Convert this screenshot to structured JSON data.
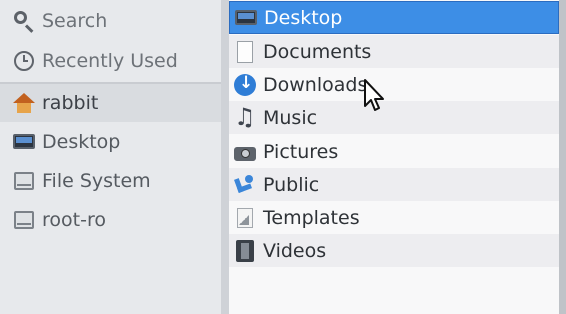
{
  "sidebar": {
    "items": [
      {
        "label": "Search",
        "icon": "search-icon"
      },
      {
        "label": "Recently Used",
        "icon": "clock-icon"
      },
      {
        "label": "rabbit",
        "icon": "home-folder-icon"
      },
      {
        "label": "Desktop",
        "icon": "desktop-icon"
      },
      {
        "label": "File System",
        "icon": "drive-icon"
      },
      {
        "label": "root-ro",
        "icon": "drive-icon"
      }
    ]
  },
  "files": {
    "rows": [
      {
        "name": "Desktop",
        "icon": "desktop-icon"
      },
      {
        "name": "Documents",
        "icon": "documents-icon"
      },
      {
        "name": "Downloads",
        "icon": "downloads-icon"
      },
      {
        "name": "Music",
        "icon": "music-icon"
      },
      {
        "name": "Pictures",
        "icon": "pictures-icon"
      },
      {
        "name": "Public",
        "icon": "public-icon"
      },
      {
        "name": "Templates",
        "icon": "templates-icon"
      },
      {
        "name": "Videos",
        "icon": "videos-icon"
      }
    ]
  },
  "colors": {
    "selection": "#3d8ee6",
    "sidebar_bg": "#e7e9ec",
    "list_bg": "#f8f8f9"
  }
}
